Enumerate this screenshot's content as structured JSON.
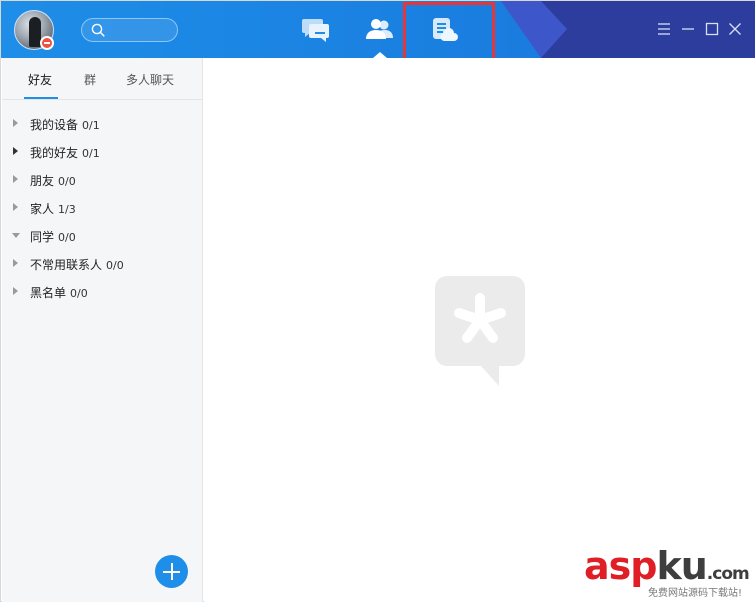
{
  "tabs": [
    {
      "label": "好友",
      "active": true
    },
    {
      "label": "群",
      "active": false
    },
    {
      "label": "多人聊天",
      "active": false
    }
  ],
  "contact_groups": [
    {
      "name": "我的设备",
      "count": "0/1",
      "expanded": false,
      "arrow_dark": false
    },
    {
      "name": "我的好友",
      "count": "0/1",
      "expanded": false,
      "arrow_dark": true
    },
    {
      "name": "朋友",
      "count": "0/0",
      "expanded": false,
      "arrow_dark": false
    },
    {
      "name": "家人",
      "count": "1/3",
      "expanded": false,
      "arrow_dark": false
    },
    {
      "name": "同学",
      "count": "0/0",
      "expanded": true,
      "arrow_dark": false
    },
    {
      "name": "不常用联系人",
      "count": "0/0",
      "expanded": false,
      "arrow_dark": false
    },
    {
      "name": "黑名单",
      "count": "0/0",
      "expanded": false,
      "arrow_dark": false
    }
  ],
  "nav": {
    "active": "contacts",
    "highlighted": "space"
  },
  "icons": {
    "nav_chat": "message-bubbles-icon",
    "nav_contacts": "contacts-icon",
    "nav_space": "qzone-document-icon",
    "search": "search-icon",
    "menu": "menu-icon",
    "minimize": "minimize-icon",
    "maximize": "maximize-icon",
    "close": "close-icon",
    "add": "plus-icon",
    "placeholder": "qq-asterisk-logo-icon"
  },
  "colors": {
    "titlebar": "#1e8ee8",
    "accent": "#1e8ee8",
    "highlight_border": "#e5373a",
    "status_busy": "#ef4f3f",
    "watermark_red": "#e01e26"
  },
  "watermark": {
    "red": "asp",
    "gray": "ku",
    "domain": ".com",
    "sub": "免费网站源码下载站!"
  }
}
